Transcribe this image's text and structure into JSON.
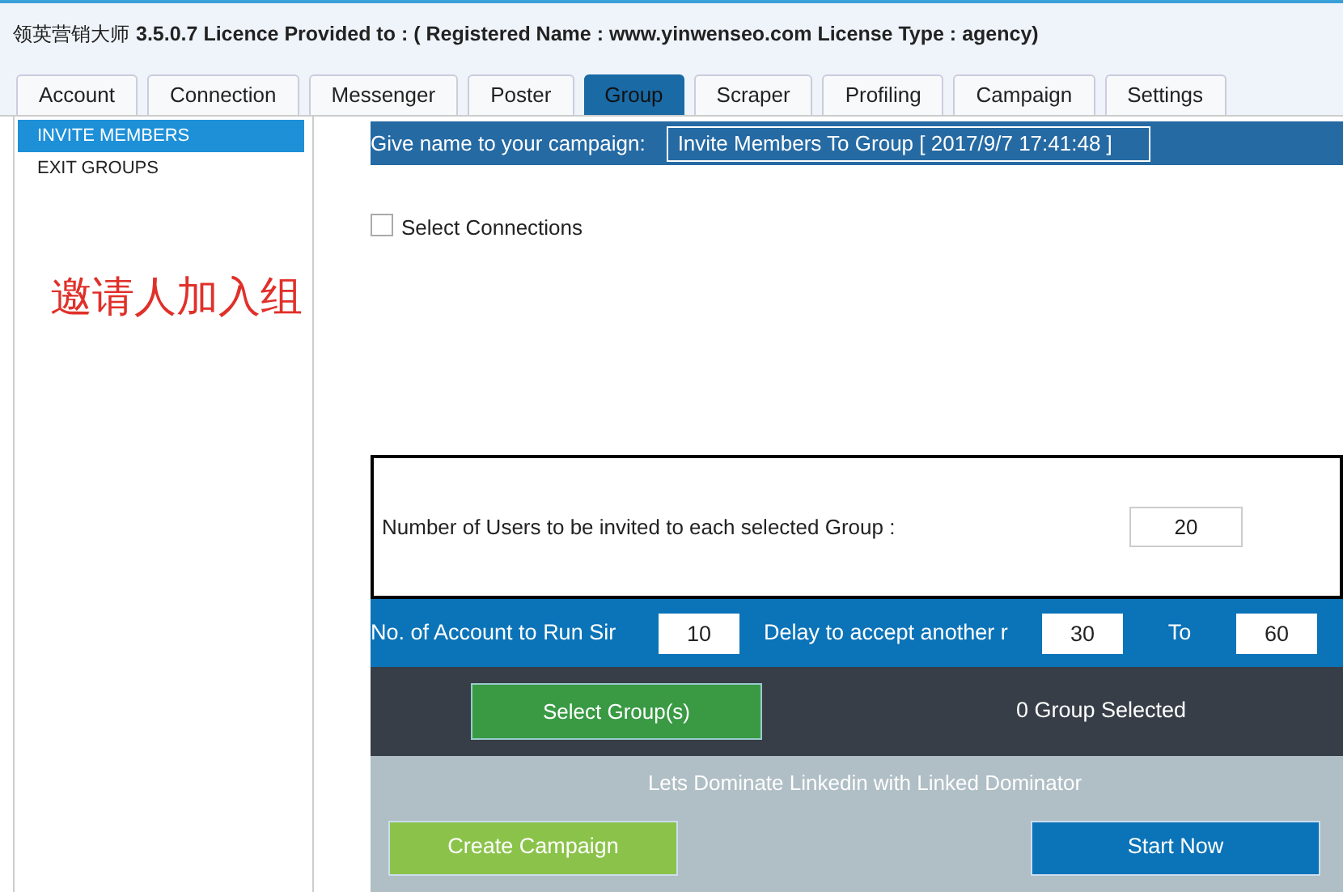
{
  "window": {
    "title_prefix": "领英营销大师",
    "title": "3.5.0.7 Licence Provided to : ( Registered Name : www.yinwenseo.com License Type : agency)"
  },
  "tabs": [
    {
      "label": "Account",
      "selected": false
    },
    {
      "label": "Connection",
      "selected": false
    },
    {
      "label": "Messenger",
      "selected": false
    },
    {
      "label": "Poster",
      "selected": false
    },
    {
      "label": "Group",
      "selected": true
    },
    {
      "label": "Scraper",
      "selected": false
    },
    {
      "label": "Profiling",
      "selected": false
    },
    {
      "label": "Campaign",
      "selected": false
    },
    {
      "label": "Settings",
      "selected": false
    }
  ],
  "sidebar": {
    "items": [
      {
        "label": "INVITE MEMBERS",
        "selected": true
      },
      {
        "label": "EXIT GROUPS",
        "selected": false
      }
    ],
    "annotation": "邀请人加入组"
  },
  "campaign_name": {
    "label": "Give name to your campaign:",
    "value": "Invite Members To Group [ 2017/9/7 17:41:48 ]"
  },
  "select_connections": {
    "label": "Select Connections",
    "checked": false
  },
  "users_per_group": {
    "label": "Number of Users to be invited to each selected Group :",
    "value": "20"
  },
  "settings_row": {
    "accounts_label": "No. of Account to Run Sir",
    "accounts_value": "10",
    "delay_label": "Delay to accept another r",
    "delay_from": "30",
    "to_label": "To",
    "delay_to": "60"
  },
  "group_row": {
    "button": "Select Group(s)",
    "status": "0 Group Selected"
  },
  "footer": {
    "tagline": "Lets Dominate Linkedin with Linked Dominator",
    "create_button": "Create Campaign",
    "start_button": "Start Now"
  }
}
